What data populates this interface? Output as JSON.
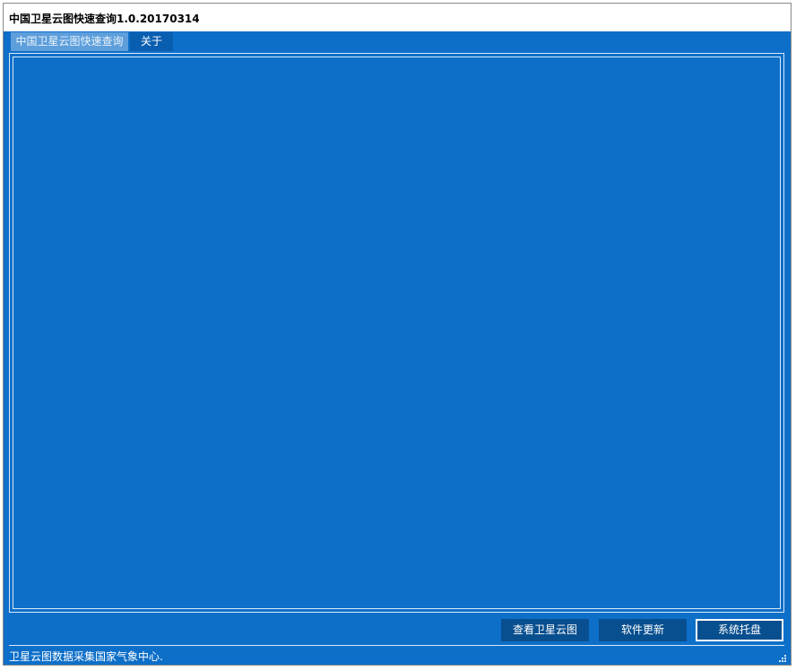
{
  "window": {
    "title": "中国卫星云图快速查询1.0.20170314"
  },
  "tabs": [
    {
      "label": "中国卫星云图快速查询",
      "active": true
    },
    {
      "label": "关于",
      "active": false
    }
  ],
  "buttons": {
    "view_label": "查看卫星云图",
    "update_label": "软件更新",
    "tray_label": "系统托盘"
  },
  "status": {
    "text": "卫星云图数据采集国家气象中心."
  },
  "colors": {
    "background": "#0e6fc9",
    "active_tab": "#5d9edb",
    "button": "#084f8f",
    "border": "#d9e9f8"
  }
}
